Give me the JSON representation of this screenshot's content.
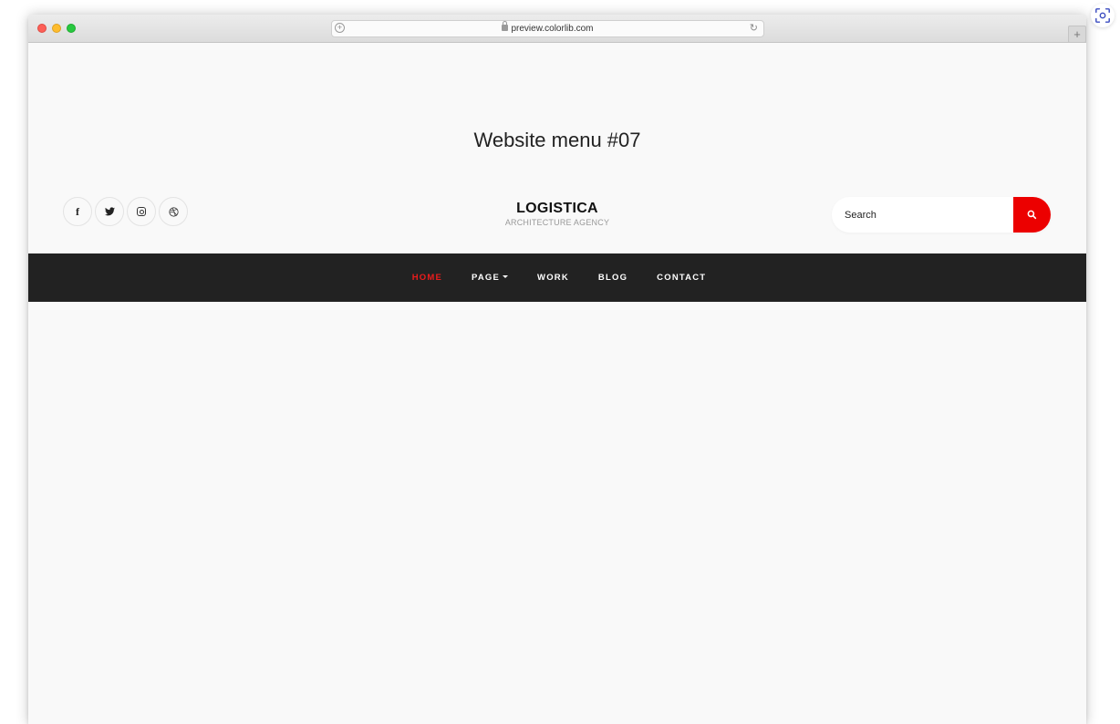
{
  "browser": {
    "url": "preview.colorlib.com",
    "new_tab_label": "+"
  },
  "page": {
    "title": "Website menu #07"
  },
  "social": [
    {
      "name": "facebook-icon",
      "glyph": "f"
    },
    {
      "name": "twitter-icon",
      "glyph": "twitter"
    },
    {
      "name": "instagram-icon",
      "glyph": "instagram"
    },
    {
      "name": "dribbble-icon",
      "glyph": "dribbble"
    }
  ],
  "logo": {
    "name": "LOGISTICA",
    "tagline": "ARCHITECTURE AGENCY"
  },
  "search": {
    "placeholder": "Search",
    "button_icon": "search-icon"
  },
  "nav": {
    "items": [
      {
        "label": "HOME",
        "active": true
      },
      {
        "label": "PAGE",
        "has_dropdown": true
      },
      {
        "label": "WORK"
      },
      {
        "label": "BLOG"
      },
      {
        "label": "CONTACT"
      }
    ]
  },
  "colors": {
    "accent": "#ec0000",
    "navbar_bg": "#222222",
    "page_bg": "#f9f9f9"
  }
}
